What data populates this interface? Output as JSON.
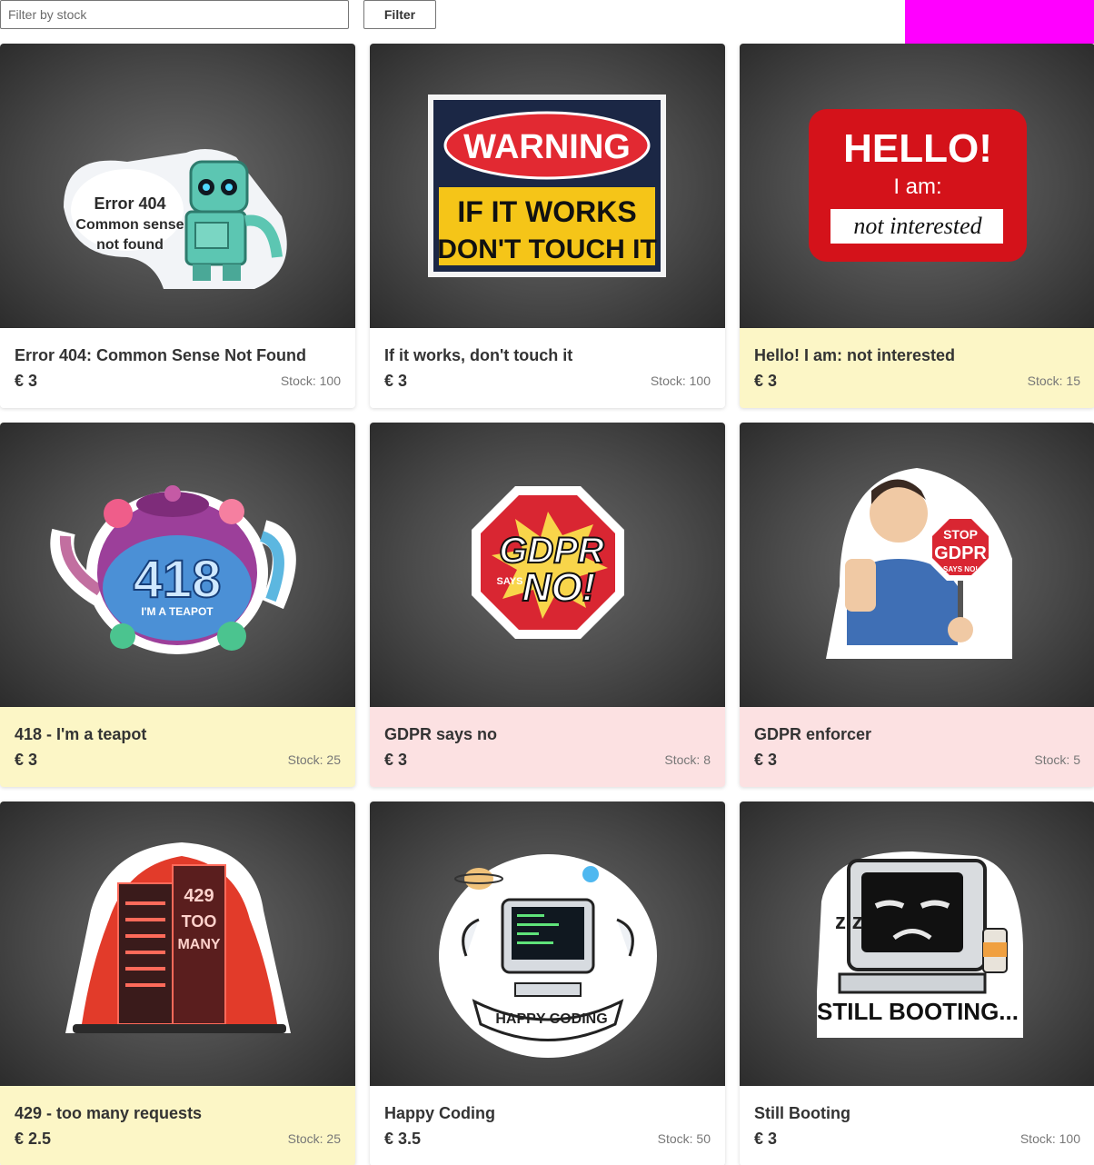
{
  "filter": {
    "placeholder": "Filter by stock",
    "button_label": "Filter"
  },
  "colors": {
    "low_stock": "#fcf6c6",
    "critical_stock": "#fce1e2",
    "accent_block": "#ff00ff"
  },
  "products": [
    {
      "title": "Error 404: Common Sense Not Found",
      "price": "€ 3",
      "stock": "Stock: 100",
      "status": "normal",
      "art": {
        "kind": "robot",
        "line1": "Error 404",
        "line2": "Common sense",
        "line3": "not found"
      }
    },
    {
      "title": "If it works, don't touch it",
      "price": "€ 3",
      "stock": "Stock: 100",
      "status": "normal",
      "art": {
        "kind": "warning",
        "line1": "WARNING",
        "line2": "IF IT WORKS",
        "line3": "DON'T TOUCH IT"
      }
    },
    {
      "title": "Hello! I am: not interested",
      "price": "€ 3",
      "stock": "Stock: 15",
      "status": "low",
      "art": {
        "kind": "nametag",
        "line1": "HELLO!",
        "line2": "I am:",
        "line3": "not interested"
      }
    },
    {
      "title": "418 - I'm a teapot",
      "price": "€ 3",
      "stock": "Stock: 25",
      "status": "low",
      "art": {
        "kind": "teapot",
        "line1": "418",
        "line2": "I'M A TEAPOT"
      }
    },
    {
      "title": "GDPR says no",
      "price": "€ 3",
      "stock": "Stock: 8",
      "status": "critical",
      "art": {
        "kind": "octagon",
        "line1": "GDPR",
        "line2": "SAYS",
        "line3": "NO!"
      }
    },
    {
      "title": "GDPR enforcer",
      "price": "€ 3",
      "stock": "Stock: 5",
      "status": "critical",
      "art": {
        "kind": "enforcer",
        "line1": "STOP",
        "line2": "GDPR",
        "line3": "SAYS NO!"
      }
    },
    {
      "title": "429 - too many requests",
      "price": "€ 2.5",
      "stock": "Stock: 25",
      "status": "low",
      "art": {
        "kind": "server",
        "line1": "429",
        "line2": "TOO",
        "line3": "MANY"
      }
    },
    {
      "title": "Happy Coding",
      "price": "€ 3.5",
      "stock": "Stock: 50",
      "status": "normal",
      "art": {
        "kind": "coding",
        "line1": "HAPPY CODING"
      }
    },
    {
      "title": "Still Booting",
      "price": "€ 3",
      "stock": "Stock: 100",
      "status": "normal",
      "art": {
        "kind": "booting",
        "line1": "STILL BOOTING...",
        "line2": "z z"
      }
    }
  ]
}
